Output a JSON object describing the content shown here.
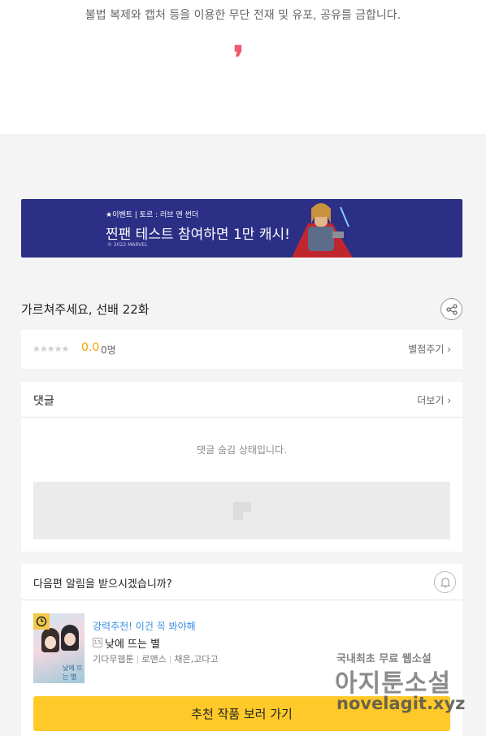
{
  "top": {
    "copyright_notice": "불법 복제와 캡처 등을 이용한 무단 전재 및 유포, 공유를 금합니다.",
    "end_mark": "❜"
  },
  "banner": {
    "subtitle": "★이벤트 | 토르 : 러브 앤 썬더",
    "headline": "찐팬 테스트 참여하면 1만 캐시!",
    "copyright": "© 2022 MARVEL"
  },
  "episode": {
    "title": "가르쳐주세요, 선배 22화",
    "share_icon": "share-icon"
  },
  "rating": {
    "stars": "★★★★★",
    "score": "0.0",
    "count": "0명",
    "rate_link": "별점주기 ›"
  },
  "comments": {
    "title": "댓글",
    "more_link": "더보기 ›",
    "hidden_message": "댓글 숨김 상태입니다."
  },
  "recommend": {
    "question": "다음편 알림을 받으시겠습니까?",
    "bell_icon": "bell-icon",
    "tagline": "강력추천! 이건 꼭 봐야해",
    "age_badge": "15",
    "work_title": "낮에 뜨는 별",
    "meta": [
      "기다무웹툰",
      "로맨스",
      "채은,고다고"
    ],
    "cover_text": "낮에 뜨는 별",
    "cta_label": "추천 작품 보러 가기"
  },
  "watermark": {
    "line1": "국내최초 무료 웹소설",
    "line2": "아지툰소설",
    "line3": "novelagit.xyz"
  },
  "colors": {
    "banner_bg": "#2b2f86",
    "score": "#f4a100",
    "tagline": "#3b8de0",
    "cta": "#ffc929",
    "end_mark": "#f2566a"
  }
}
